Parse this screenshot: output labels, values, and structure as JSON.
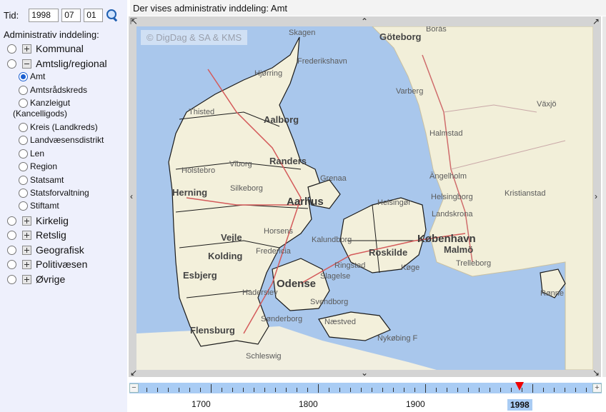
{
  "sidebar": {
    "date_label": "Tid:",
    "year": "1998",
    "month": "07",
    "day": "01",
    "admin_title": "Administrativ inddeling:",
    "top_items": [
      {
        "label": "Kommunal"
      },
      {
        "label": "Amtslig/regional"
      },
      {
        "label": "Kirkelig"
      },
      {
        "label": "Retslig"
      },
      {
        "label": "Geografisk"
      },
      {
        "label": "Politivæsen"
      },
      {
        "label": "Øvrige"
      }
    ],
    "sub_items": [
      {
        "label": "Amt",
        "selected": true
      },
      {
        "label": "Amtsrådskreds"
      },
      {
        "label": "Kanzleigut"
      },
      {
        "label": "(Kancelligods)"
      },
      {
        "label": "Kreis (Landkreds)"
      },
      {
        "label": "Landvæsensdistrikt"
      },
      {
        "label": "Len"
      },
      {
        "label": "Region"
      },
      {
        "label": "Statsamt"
      },
      {
        "label": "Statsforvaltning"
      },
      {
        "label": "Stiftamt"
      }
    ]
  },
  "header": {
    "text": "Der vises administrativ inddeling:  Amt"
  },
  "map": {
    "copyright": "© DigDag & SA & KMS",
    "labels": {
      "skagen": "Skagen",
      "goteborg": "Göteborg",
      "boras": "Borås",
      "frederikshavn": "Frederikshavn",
      "hjorring": "Hjørring",
      "varberg": "Varberg",
      "vaxjo": "Växjö",
      "thisted": "Thisted",
      "aalborg": "Aalborg",
      "halmstad": "Halmstad",
      "randers": "Randers",
      "grenaa": "Grenaa",
      "holstebro": "Holstebro",
      "viborg": "Viborg",
      "silkeborg": "Silkeborg",
      "angelholm": "Ängelholm",
      "herning": "Herning",
      "aarhus": "Aarhus",
      "helsingborg": "Helsingborg",
      "kristianstad": "Kristianstad",
      "helsingor": "Helsingør",
      "landskrona": "Landskrona",
      "vejle": "Vejle",
      "horsens": "Horsens",
      "kalundborg": "Kalundborg",
      "kobenhavn": "København",
      "roskilde": "Roskilde",
      "malmo": "Malmö",
      "kolding": "Kolding",
      "fredericia": "Fredericia",
      "ringsted": "Ringsted",
      "trelleborg": "Trelleborg",
      "esbjerg": "Esbjerg",
      "slagelse": "Slagelse",
      "koge": "Køge",
      "haderslev": "Haderslev",
      "odense": "Odense",
      "ronne": "Rønne",
      "svendborg": "Svendborg",
      "naestved": "Næstved",
      "flensburg": "Flensburg",
      "sonderborg": "Sønderborg",
      "nykobing": "Nykøbing F",
      "schleswig": "Schleswig"
    }
  },
  "timeline": {
    "years": [
      "1700",
      "1800",
      "1900"
    ],
    "current_year": "1998",
    "plus": "+",
    "minus": "−"
  },
  "colors": {
    "sidebar_bg": "#eef0fc",
    "sea": "#a9c7ec",
    "land": "#f3f0db",
    "timeline": "#a9ccf4",
    "marker": "#e00000"
  }
}
